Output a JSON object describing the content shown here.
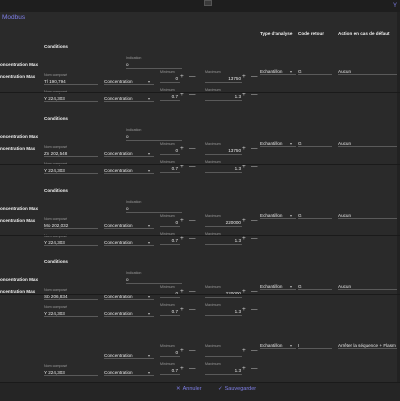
{
  "app": {
    "corner_label": "Y",
    "section_title": "Modbus"
  },
  "headers": {
    "conditions": "Conditions",
    "type_analyse": "Type d'analyse",
    "code_retour": "Code retour",
    "action_defaut": "Action en cas de défaut"
  },
  "labels": {
    "indication": "Indication",
    "nom_compose": "Nom composé",
    "minimum": "Minimum",
    "maximum": "Maximum"
  },
  "controls": {
    "plus": "+",
    "minus": "—"
  },
  "rows": [
    {
      "name_top": "oncentration Max",
      "name_bottom": "ncentration Max",
      "indication": "o",
      "compose1": "Tl 190,794",
      "compose2": "Y 224,303",
      "concentration1": "Concentration",
      "concentration2": "Concentration",
      "min1": "0",
      "max1": "13750",
      "min2": "0.7",
      "max2": "1.3",
      "type_analyse": "Echantillon",
      "code_retour": "G",
      "action": "Aucun"
    },
    {
      "name_top": "oncentration Max",
      "name_bottom": "ncentration Max",
      "indication": "o",
      "compose1": "Zn 202,548",
      "compose2": "Y 224,303",
      "concentration1": "Concentration",
      "concentration2": "Concentration",
      "min1": "0",
      "max1": "13750",
      "min2": "0.7",
      "max2": "1.3",
      "type_analyse": "Echantillon",
      "code_retour": "G",
      "action": "Aucun"
    },
    {
      "name_top": "oncentration Max",
      "name_bottom": "ncentration Max",
      "indication": "o",
      "compose1": "Mo 202,032",
      "compose2": "Y 224,303",
      "concentration1": "Concentration",
      "concentration2": "Concentration",
      "min1": "0",
      "max1": "220000",
      "min2": "0.7",
      "max2": "1.3",
      "type_analyse": "Echantillon",
      "code_retour": "G",
      "action": "Aucun"
    },
    {
      "name_top": "oncentration Max",
      "name_bottom": "ncentration Max",
      "indication": "o",
      "compose1": "Sb 206,834",
      "compose2": "Y 224,303",
      "concentration1": "Concentration",
      "concentration2": "Concentration",
      "min1": "0",
      "max1": "220000",
      "min2": "0.7",
      "max2": "1.3",
      "type_analyse": "Echantillon",
      "code_retour": "G",
      "action": "Aucun"
    },
    {
      "name_top": "",
      "name_bottom": "",
      "indication": "",
      "compose1": "",
      "compose2": "Y 224,303",
      "concentration1": "Concentration",
      "concentration2": "Concentration",
      "min1": "0",
      "max1": "",
      "min2": "0.7",
      "max2": "1.3",
      "type_analyse": "Echantillon",
      "code_retour": "I",
      "action": "Arrêter la séquence + Flasm"
    }
  ],
  "footer": {
    "cancel": "Annuler",
    "save": "Sauvegarder"
  }
}
